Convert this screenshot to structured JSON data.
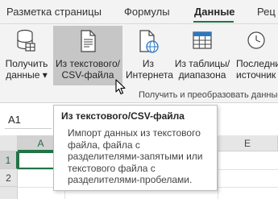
{
  "ribbon_tabs": [
    {
      "label": "Разметка страницы",
      "active": false
    },
    {
      "label": "Формулы",
      "active": false
    },
    {
      "label": "Данные",
      "active": true
    },
    {
      "label": "Рец",
      "active": false
    }
  ],
  "ribbon_buttons": {
    "get_data": {
      "line1": "Получить",
      "line2": "данные ▾"
    },
    "from_text": {
      "line1": "Из текстового/",
      "line2": "CSV-файла"
    },
    "from_web": {
      "line1": "Из",
      "line2": "Интернета"
    },
    "from_table": {
      "line1": "Из таблицы/",
      "line2": "диапазона"
    },
    "recent": {
      "line1": "Последни",
      "line2": "источник"
    }
  },
  "group_label": "Получить и преобразовать данные",
  "name_box": "A1",
  "columns": [
    "A",
    "E"
  ],
  "rows": [
    "1",
    "2"
  ],
  "tooltip": {
    "title": "Из текстового/CSV-файла",
    "lines": [
      "Импорт данных из текстового",
      "файла, файла с",
      "разделителями-запятыми или",
      "текстового файла с",
      "разделителями-пробелами."
    ]
  },
  "colors": {
    "accent": "#217346",
    "hover": "#c6c6c6"
  }
}
